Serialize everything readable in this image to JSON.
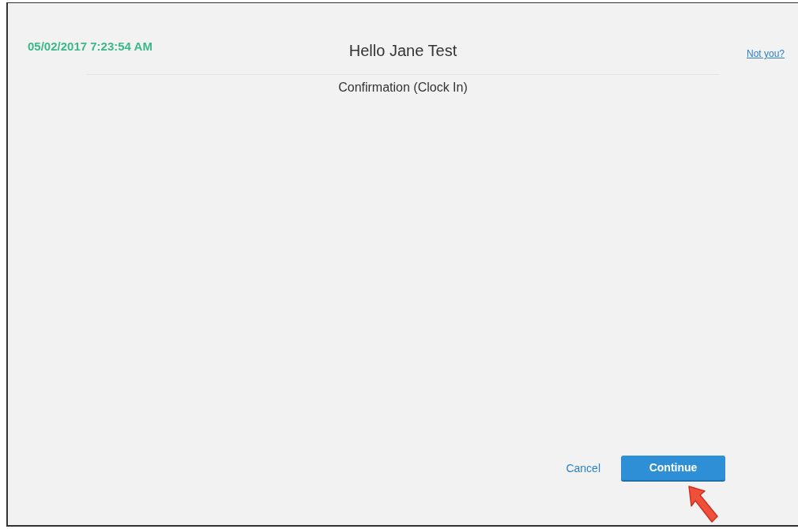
{
  "header": {
    "datetime": "05/02/2017 7:23:54 AM",
    "greeting": "Hello Jane Test",
    "not_you_link": "Not you?"
  },
  "subtitle": "Confirmation (Clock In)",
  "actions": [
    {
      "kind": "link",
      "label": "Cancel"
    },
    {
      "kind": "primary",
      "label": "Continue"
    }
  ]
}
